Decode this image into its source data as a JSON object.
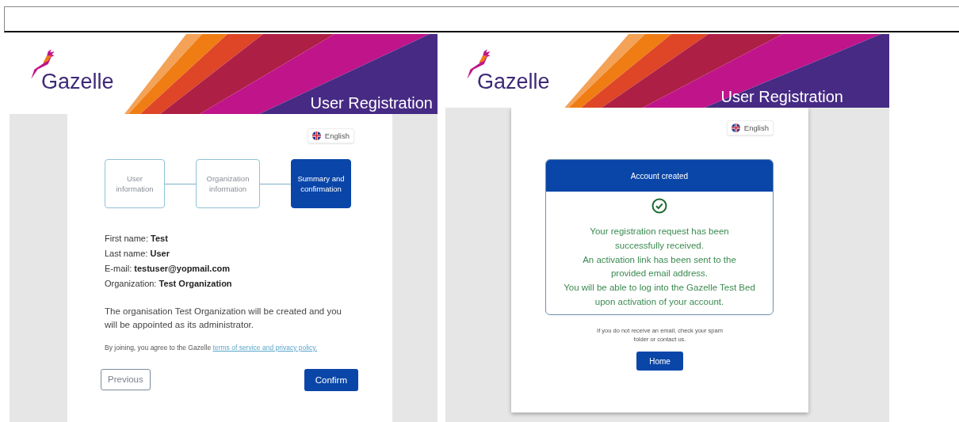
{
  "summary_page": {
    "logo": "Gazelle",
    "header_title": "User Registration",
    "language": "English",
    "steps": [
      {
        "label": "User information",
        "selected": false
      },
      {
        "label": "Organization information",
        "selected": false
      },
      {
        "label": "Summary and confirmation",
        "selected": true
      }
    ],
    "fields": [
      {
        "label": "First name:",
        "value": "Test"
      },
      {
        "label": "Last name:",
        "value": "User"
      },
      {
        "label": "E-mail:",
        "value": "testuser@yopmail.com"
      },
      {
        "label": "Organization:",
        "value": "Test Organization"
      }
    ],
    "notice": "The organisation Test Organization will be created and you will be appointed as its administrator.",
    "terms": {
      "text": "By joining, you agree to the Gazelle",
      "link": "terms of service and privacy policy."
    },
    "buttons": [
      {
        "label": "Previous",
        "kind": "secondary"
      },
      {
        "label": "Confirm",
        "kind": "primary"
      }
    ]
  },
  "success_page": {
    "logo": "Gazelle",
    "header_title": "User Registration",
    "language": "English",
    "card_title": "Account created",
    "messages": [
      "Your registration request has been successfully received.",
      "An activation link has been sent to the provided email address.",
      "You will be able to log into the Gazelle Test Bed upon activation of your account."
    ],
    "hint": "If you do not receive an email, check your spam folder or contact us.",
    "buttons": [
      {
        "label": "Home",
        "kind": "primary"
      }
    ]
  }
}
